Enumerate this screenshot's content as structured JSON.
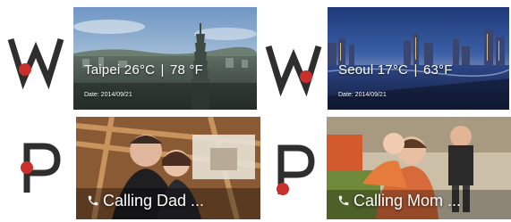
{
  "colors": {
    "logo_dark": "#2e2e2e",
    "logo_dot": "#c9302c",
    "text": "#ffffff"
  },
  "logos": {
    "weather_letter": "W",
    "phone_letter": "P"
  },
  "weather_cards": [
    {
      "city": "Taipei",
      "temp_c": "26°C",
      "temp_f": "78 °F",
      "separator": "|",
      "date": "Date: 2014/09/21"
    },
    {
      "city": "Seoul",
      "temp_c": "17°C",
      "temp_f": "63°F",
      "separator": "|",
      "date": "Date: 2014/09/21"
    }
  ],
  "call_cards": [
    {
      "icon": "phone-icon",
      "label": "Calling  Dad ..."
    },
    {
      "icon": "phone-icon",
      "label": "Calling  Mom ..."
    }
  ]
}
